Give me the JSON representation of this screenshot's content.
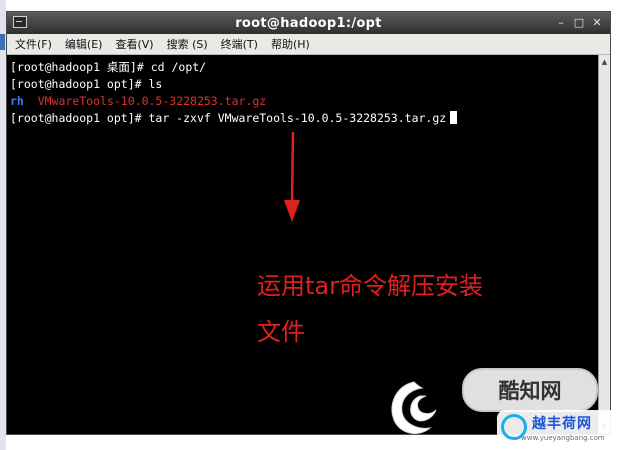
{
  "window": {
    "title": "root@hadoop1:/opt"
  },
  "menu": [
    {
      "label": "文件(F)"
    },
    {
      "label": "编辑(E)"
    },
    {
      "label": "查看(V)"
    },
    {
      "label": "搜索 (S)"
    },
    {
      "label": "终端(T)"
    },
    {
      "label": "帮助(H)"
    }
  ],
  "terminal": {
    "lines": [
      {
        "prompt": "[root@hadoop1 桌面]# ",
        "command": "cd /opt/"
      },
      {
        "prompt": "[root@hadoop1 opt]# ",
        "command": "ls"
      },
      {
        "ls_dir": "rh",
        "ls_file": "VMwareTools-10.0.5-3228253.tar.gz"
      },
      {
        "prompt": "[root@hadoop1 opt]# ",
        "command": "tar -zxvf VMwareTools-10.0.5-3228253.tar.gz"
      }
    ]
  },
  "annotation": {
    "line1": "运用tar命令解压安装",
    "line2": "文件",
    "color": "#e0201e"
  },
  "watermark": {
    "badge": "酷知网",
    "site_name": "越丰荷网",
    "site_url": "www.yueyangbang.com"
  },
  "colors": {
    "terminal_bg": "#000000",
    "terminal_fg": "#ffffff",
    "ls_dir": "#3c7df0",
    "ls_file": "#e03030"
  }
}
